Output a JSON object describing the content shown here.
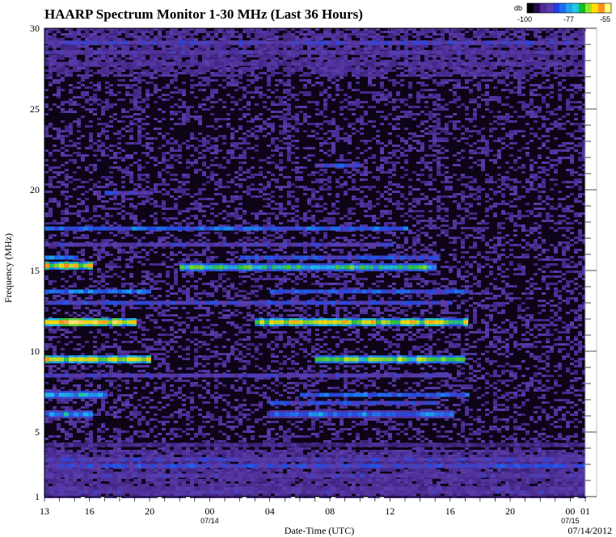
{
  "chart_data": {
    "type": "heatmap",
    "title": "HAARP Spectrum Monitor 1-30 MHz (Last 36 Hours)",
    "xlabel": "Date-Time (UTC)",
    "ylabel": "Frequency (MHz)",
    "date_label": "07/14/2012",
    "ylim": [
      1,
      30
    ],
    "y_ticks": [
      1,
      5,
      10,
      15,
      20,
      25,
      30
    ],
    "x_ticks": [
      {
        "label": "13",
        "hour": 13
      },
      {
        "label": "16",
        "hour": 16
      },
      {
        "label": "20",
        "hour": 20
      },
      {
        "label": "00",
        "hour": 24,
        "date": "07/14"
      },
      {
        "label": "04",
        "hour": 28
      },
      {
        "label": "08",
        "hour": 32
      },
      {
        "label": "12",
        "hour": 36
      },
      {
        "label": "16",
        "hour": 40
      },
      {
        "label": "20",
        "hour": 44
      },
      {
        "label": "00",
        "hour": 48,
        "date": "07/15"
      },
      {
        "label": "01",
        "hour": 49
      }
    ],
    "xlim": [
      13,
      49
    ],
    "colorbar": {
      "unit": "db",
      "range": [
        -100,
        -55
      ],
      "tick_labels": [
        "-100",
        "-77",
        "-55"
      ],
      "colors": [
        "#000000",
        "#2a0a4a",
        "#4b2c8f",
        "#5a3aae",
        "#1e40e0",
        "#1e6ef0",
        "#20a0f0",
        "#20c8e0",
        "#10c020",
        "#a0e020",
        "#ffe000",
        "#ff9020",
        "#ffff80"
      ]
    },
    "bands": [
      {
        "f": 1.3,
        "start": 13,
        "end": 49,
        "level": 0.42
      },
      {
        "f": 1.5,
        "start": 13,
        "end": 49,
        "level": 0.38
      },
      {
        "f": 2.3,
        "start": 13,
        "end": 49,
        "level": 0.42
      },
      {
        "f": 2.9,
        "start": 13,
        "end": 49,
        "level": 0.52
      },
      {
        "f": 3.3,
        "start": 13,
        "end": 49,
        "level": 0.45
      },
      {
        "f": 4.2,
        "start": 13,
        "end": 49,
        "level": 0.3
      },
      {
        "f": 6.1,
        "start": 13,
        "end": 16,
        "level": 0.66
      },
      {
        "f": 6.1,
        "start": 28,
        "end": 40,
        "level": 0.62
      },
      {
        "f": 6.8,
        "start": 28,
        "end": 39,
        "level": 0.52
      },
      {
        "f": 7.3,
        "start": 13,
        "end": 17,
        "level": 0.66
      },
      {
        "f": 7.3,
        "start": 30,
        "end": 41,
        "level": 0.58
      },
      {
        "f": 8.5,
        "start": 13,
        "end": 40,
        "level": 0.44
      },
      {
        "f": 9.5,
        "start": 13,
        "end": 20,
        "level": 0.86
      },
      {
        "f": 9.5,
        "start": 31,
        "end": 41,
        "level": 0.8
      },
      {
        "f": 11.8,
        "start": 13,
        "end": 19,
        "level": 0.9
      },
      {
        "f": 11.8,
        "start": 27,
        "end": 41,
        "level": 0.84
      },
      {
        "f": 13.0,
        "start": 13,
        "end": 40,
        "level": 0.5
      },
      {
        "f": 13.7,
        "start": 13,
        "end": 20,
        "level": 0.6
      },
      {
        "f": 13.7,
        "start": 28,
        "end": 41,
        "level": 0.56
      },
      {
        "f": 15.3,
        "start": 13,
        "end": 16,
        "level": 0.86
      },
      {
        "f": 15.2,
        "start": 22,
        "end": 39,
        "level": 0.74
      },
      {
        "f": 15.8,
        "start": 13,
        "end": 15,
        "level": 0.6
      },
      {
        "f": 15.8,
        "start": 26,
        "end": 39,
        "level": 0.52
      },
      {
        "f": 17.6,
        "start": 13,
        "end": 37,
        "level": 0.58
      },
      {
        "f": 16.6,
        "start": 13,
        "end": 36,
        "level": 0.44
      },
      {
        "f": 19.8,
        "start": 17,
        "end": 20,
        "level": 0.48
      },
      {
        "f": 21.5,
        "start": 31,
        "end": 34,
        "level": 0.52
      },
      {
        "f": 29.1,
        "start": 13,
        "end": 49,
        "level": 0.46
      },
      {
        "f": 28.5,
        "start": 13,
        "end": 49,
        "level": 0.4
      },
      {
        "f": 27.8,
        "start": 13,
        "end": 49,
        "level": 0.36
      }
    ]
  }
}
